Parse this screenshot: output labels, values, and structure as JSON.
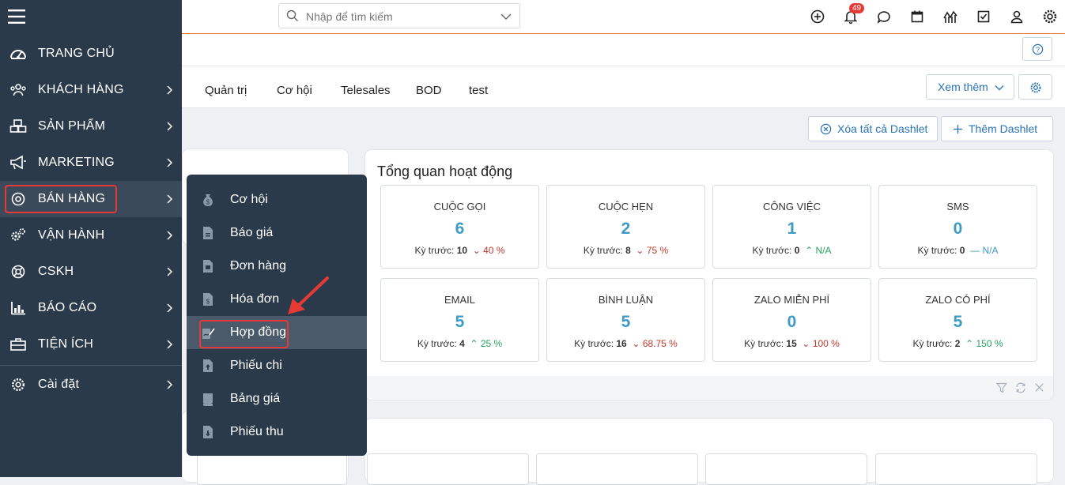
{
  "search": {
    "placeholder": "Nhập để tìm kiếm"
  },
  "topbar": {
    "notification_count": "49"
  },
  "tabs": [
    {
      "label": "Quản trị"
    },
    {
      "label": "Cơ hội"
    },
    {
      "label": "Telesales"
    },
    {
      "label": "BOD"
    },
    {
      "label": "test"
    }
  ],
  "tabs_more_label": "Xem thêm",
  "dashlet_actions": {
    "clear_all": "Xóa tất cả Dashlet",
    "add": "Thêm Dashlet"
  },
  "overview": {
    "title": "Tổng quan hoạt động",
    "prev_label": "Kỳ trước:",
    "stats": [
      {
        "label": "CUỘC GỌI",
        "value": "6",
        "prev": "10",
        "change": "40 %",
        "trend": "down"
      },
      {
        "label": "CUỘC HẸN",
        "value": "2",
        "prev": "8",
        "change": "75 %",
        "trend": "down"
      },
      {
        "label": "CÔNG VIỆC",
        "value": "1",
        "prev": "0",
        "change": "N/A",
        "trend": "up"
      },
      {
        "label": "SMS",
        "value": "0",
        "prev": "0",
        "change": "N/A",
        "trend": "flat"
      },
      {
        "label": "EMAIL",
        "value": "5",
        "prev": "4",
        "change": "25 %",
        "trend": "up"
      },
      {
        "label": "BÌNH LUẬN",
        "value": "5",
        "prev": "16",
        "change": "68.75 %",
        "trend": "down"
      },
      {
        "label": "ZALO MIỄN PHÍ",
        "value": "0",
        "prev": "15",
        "change": "100 %",
        "trend": "down"
      },
      {
        "label": "ZALO CÓ PHÍ",
        "value": "5",
        "prev": "2",
        "change": "150 %",
        "trend": "up"
      }
    ]
  },
  "sidebar": {
    "items": [
      {
        "label": "TRANG CHỦ",
        "icon": "dashboard-icon"
      },
      {
        "label": "KHÁCH HÀNG",
        "icon": "users-icon"
      },
      {
        "label": "SẢN PHẨM",
        "icon": "boxes-icon"
      },
      {
        "label": "MARKETING",
        "icon": "megaphone-icon"
      },
      {
        "label": "BÁN HÀNG",
        "icon": "target-icon"
      },
      {
        "label": "VẬN HÀNH",
        "icon": "gears-icon"
      },
      {
        "label": "CSKH",
        "icon": "lifebuoy-icon"
      },
      {
        "label": "BÁO CÁO",
        "icon": "bar-chart-icon"
      },
      {
        "label": "TIỆN ÍCH",
        "icon": "toolbox-icon"
      }
    ],
    "settings_label": "Cài đặt"
  },
  "submenu": {
    "items": [
      {
        "label": "Cơ hội",
        "icon": "money-bag-icon"
      },
      {
        "label": "Báo giá",
        "icon": "document-icon"
      },
      {
        "label": "Đơn hàng",
        "icon": "order-icon"
      },
      {
        "label": "Hóa đơn",
        "icon": "invoice-icon"
      },
      {
        "label": "Hợp đồng",
        "icon": "contract-icon"
      },
      {
        "label": "Phiếu chi",
        "icon": "upload-doc-icon"
      },
      {
        "label": "Bảng giá",
        "icon": "price-book-icon"
      },
      {
        "label": "Phiếu thu",
        "icon": "download-doc-icon"
      }
    ]
  },
  "colors": {
    "sidebar_bg": "#2b3a4a",
    "accent": "#2a73b7",
    "highlight": "#e53935",
    "value": "#3d9bc4"
  }
}
